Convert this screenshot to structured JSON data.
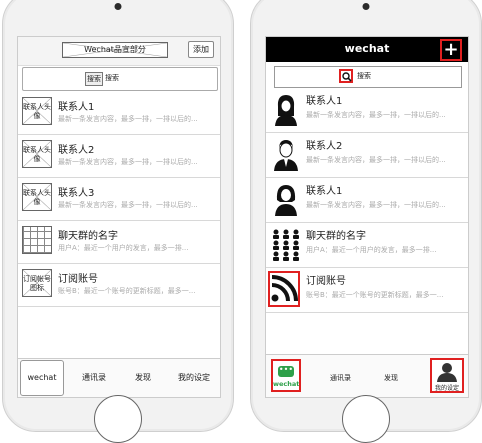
{
  "left": {
    "title": "Wechat品宣部分",
    "add_label": "添加",
    "search": {
      "button": "搜索",
      "text": "搜索"
    },
    "items": [
      {
        "avatar": "联系人头像",
        "name": "联系人1",
        "preview": "最新一条发言内容，最多一排，一排以后的..."
      },
      {
        "avatar": "联系人头像",
        "name": "联系人2",
        "preview": "最新一条发言内容，最多一排，一排以后的..."
      },
      {
        "avatar": "联系人头像",
        "name": "联系人3",
        "preview": "最新一条发言内容，最多一排，一排以后的..."
      },
      {
        "avatar": "",
        "name": "聊天群的名字",
        "preview": "用户A：最近一个用户的发言，最多一排..."
      },
      {
        "avatar": "订阅帐号图标",
        "name": "订阅账号",
        "preview": "账号B：最近一个账号的更新标题，最多一..."
      }
    ],
    "tabs": [
      "wechat",
      "通讯录",
      "发现",
      "我的设定"
    ]
  },
  "right": {
    "title": "wechat",
    "search_text": "搜索",
    "items": [
      {
        "name": "联系人1",
        "preview": "最新一条发言内容，最多一排，一排以后的..."
      },
      {
        "name": "联系人2",
        "preview": "最新一条发言内容，最多一排，一排以后的..."
      },
      {
        "name": "联系人1",
        "preview": "最新一条发言内容，最多一排，一排以后的..."
      },
      {
        "name": "聊天群的名字",
        "preview": "用户A：最近一个用户的发言，最多一排..."
      },
      {
        "name": "订阅账号",
        "preview": "账号B：最近一个账号的更新标题，最多一..."
      }
    ],
    "tabs": [
      "wechat",
      "通讯录",
      "发现",
      "我的设定"
    ]
  },
  "colors": {
    "highlight": "#e02020",
    "wechat_green": "#2ea04a",
    "header_black": "#000000"
  },
  "icons": {
    "add": "plus-icon",
    "search": "magnifier-icon",
    "feed": "rss-icon",
    "me": "person-icon",
    "chat": "chat-bubble-icon"
  }
}
